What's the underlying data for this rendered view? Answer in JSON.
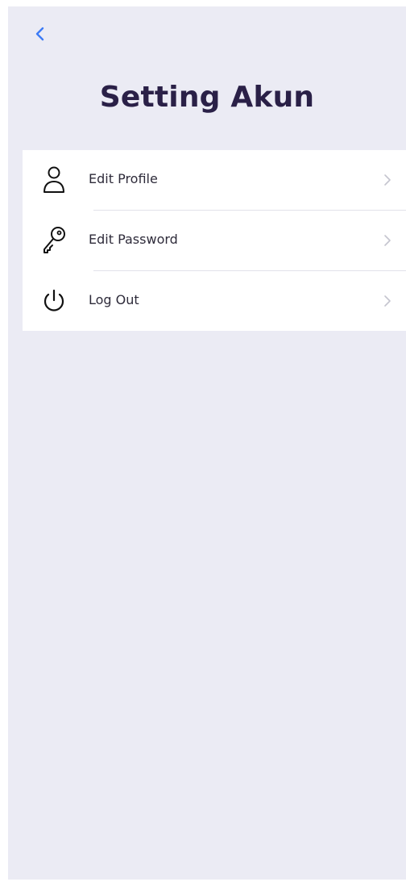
{
  "header": {
    "back_icon": "chevron-left-icon",
    "title": "Setting Akun"
  },
  "menu": {
    "items": [
      {
        "label": "Edit Profile",
        "icon": "user-icon"
      },
      {
        "label": "Edit Password",
        "icon": "key-icon"
      },
      {
        "label": "Log Out",
        "icon": "power-icon"
      }
    ]
  },
  "colors": {
    "background": "#ebebf4",
    "card": "#ffffff",
    "title": "#2a2047",
    "accent": "#3d7bf5",
    "chevron": "#c5c5cf"
  }
}
